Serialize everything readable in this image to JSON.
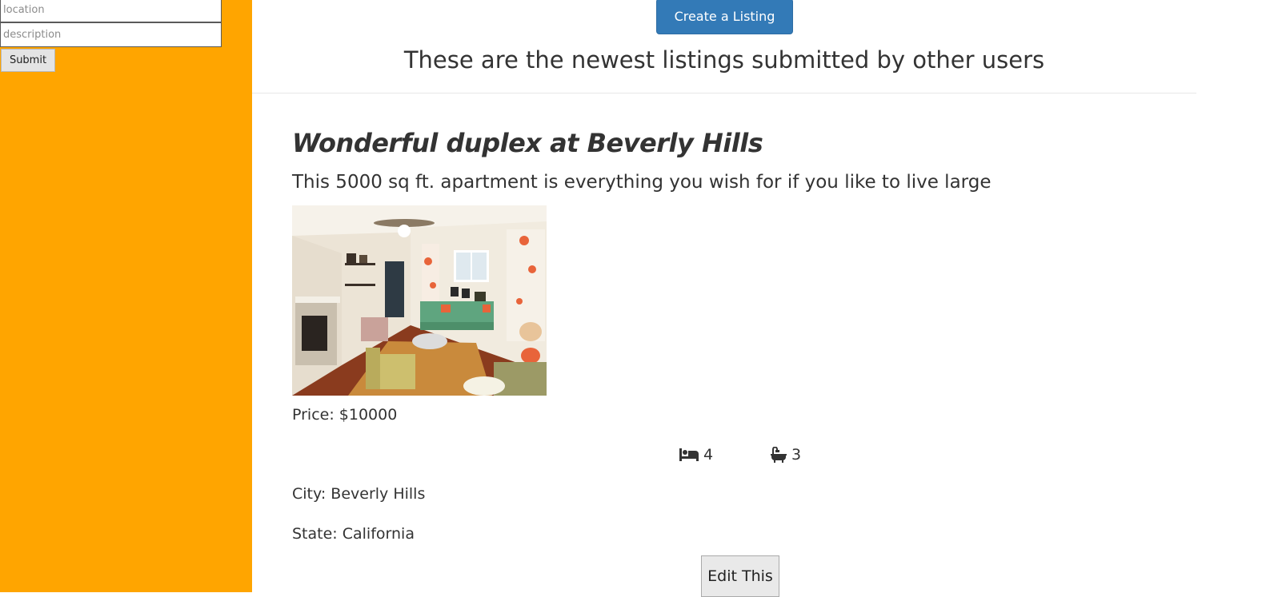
{
  "sidebar": {
    "location_placeholder": "location",
    "description_placeholder": "description",
    "submit_label": "Submit",
    "background_color": "#ffa500"
  },
  "header": {
    "create_button_label": "Create a Listing",
    "heading": "These are the newest listings submitted by other users",
    "accent_color": "#337ab7"
  },
  "listing": {
    "title": "Wonderful duplex at Beverly Hills",
    "description": "This 5000 sq ft. apartment is everything you wish for if you like to live large",
    "price": "Price: $10000",
    "beds": "4",
    "baths": "3",
    "bed_icon": "bed-icon",
    "bath_icon": "bath-icon",
    "city": "City: Beverly Hills",
    "state": "State: California",
    "edit_label": "Edit This"
  }
}
